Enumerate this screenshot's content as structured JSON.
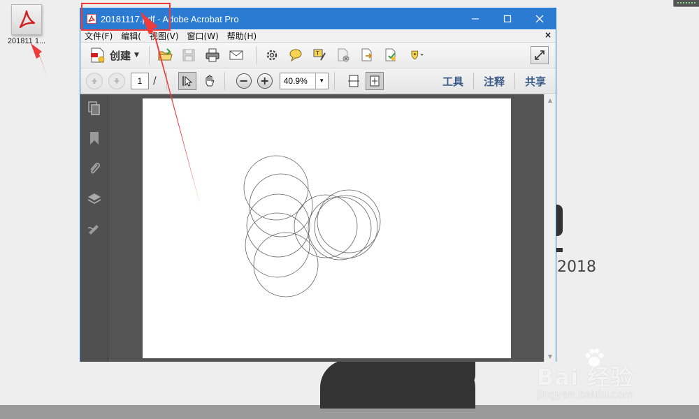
{
  "desktop": {
    "icon_label": "201811 1...",
    "background_text": "2018"
  },
  "watermark": {
    "logo": "Bai  经验",
    "url": "jingyan.baidu.com"
  },
  "window": {
    "title": "20181117.pdf - Adobe Acrobat Pro",
    "accent_color": "#2b7bd3"
  },
  "menu": {
    "items": [
      "文件(F)",
      "编辑(",
      "视图(V)",
      "窗口(W)",
      "帮助(H)"
    ],
    "close": "×"
  },
  "toolbar": {
    "create_label": "创建",
    "icons": [
      "open-folder-icon",
      "save-icon",
      "print-icon",
      "email-icon",
      "gear-icon",
      "comment-icon",
      "highlight-icon",
      "delete-file-icon",
      "export-icon",
      "sign-icon",
      "stamp-icon"
    ]
  },
  "navbar": {
    "page_number": "1",
    "page_slash": "/",
    "zoom_value": "40.9%",
    "zoom_out": "−",
    "zoom_in": "+",
    "tabs": [
      "工具",
      "注释",
      "共享"
    ]
  },
  "document": {
    "shape": "circles",
    "circle_count": 9
  },
  "annotation": {
    "color": "#ee3b3b"
  }
}
